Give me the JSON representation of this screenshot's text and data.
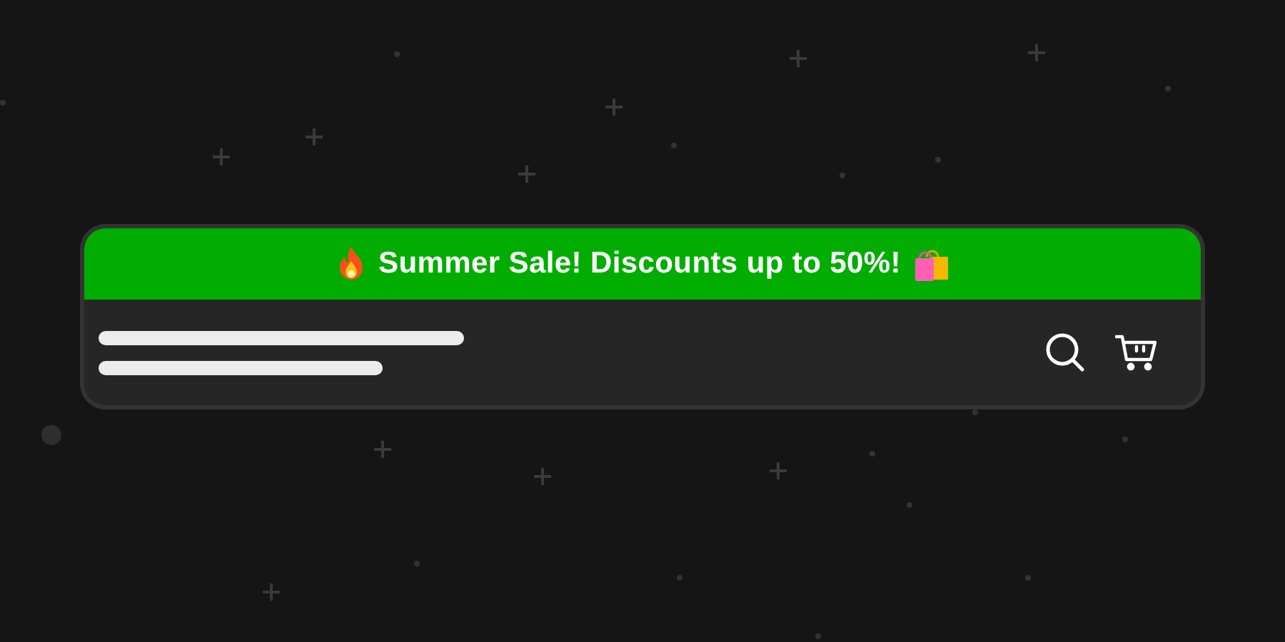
{
  "banner": {
    "text": "Summer Sale! Discounts up to 50%!"
  }
}
